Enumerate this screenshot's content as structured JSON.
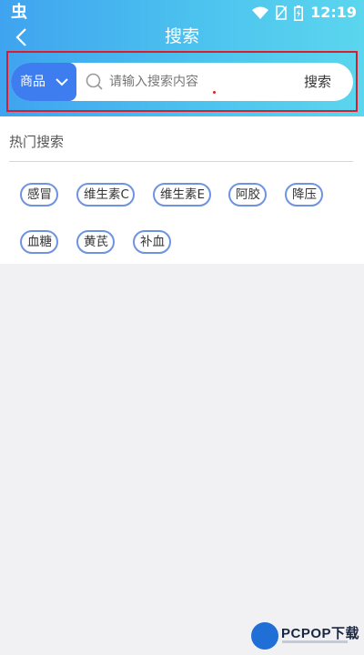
{
  "status_bar": {
    "app_logo": "虫",
    "time": "12:19",
    "icons": [
      "wifi-icon",
      "no-sim-icon",
      "battery-icon"
    ]
  },
  "header": {
    "title": "搜索",
    "back_icon": "chevron-left-icon"
  },
  "search": {
    "category": "商品",
    "category_icon": "chevron-down-icon",
    "search_icon": "search-icon",
    "placeholder": "请输入搜索内容",
    "value": "",
    "button_label": "搜索"
  },
  "hot_search": {
    "title": "热门搜索",
    "tags": [
      "感冒",
      "维生素C",
      "维生素E",
      "阿胶",
      "降压",
      "血糖",
      "黄芪",
      "补血"
    ]
  },
  "watermark": {
    "text": "PCPOP下载"
  },
  "colors": {
    "header_gradient_start": "#3fa3ef",
    "header_gradient_end": "#5bd6ee",
    "category_button": "#3d7df0",
    "tag_border": "#6f93e0",
    "highlight_box": "#d81e2c",
    "page_background": "#f1f1f3"
  }
}
